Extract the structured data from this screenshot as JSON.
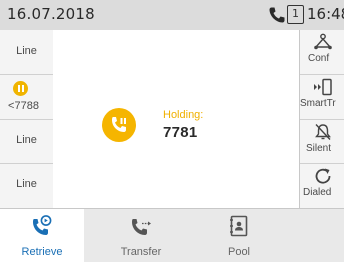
{
  "status_bar": {
    "date": "16.07.2018",
    "line_number": "1",
    "time": "16:48"
  },
  "left_keys": [
    {
      "label": "Line"
    },
    {
      "label": "<7788",
      "state": "hold"
    },
    {
      "label": "Line"
    },
    {
      "label": "Line"
    }
  ],
  "call": {
    "status": "Holding:",
    "number": "7781"
  },
  "right_keys": [
    {
      "label": "Conf",
      "icon": "conference-icon"
    },
    {
      "label": "SmartTr",
      "icon": "smart-transfer-icon"
    },
    {
      "label": "Silent",
      "icon": "silent-bell-icon"
    },
    {
      "label": "Dialed",
      "icon": "redial-icon"
    }
  ],
  "bottom_tabs": [
    {
      "label": "Retrieve",
      "icon": "retrieve-call-icon",
      "active": true
    },
    {
      "label": "Transfer",
      "icon": "transfer-call-icon",
      "active": false
    },
    {
      "label": "Pool",
      "icon": "pool-contacts-icon",
      "active": false
    }
  ],
  "colors": {
    "accent_blue": "#1a6fb5",
    "hold_yellow": "#f5b500",
    "status_bar_bg": "#dcdcdc"
  }
}
